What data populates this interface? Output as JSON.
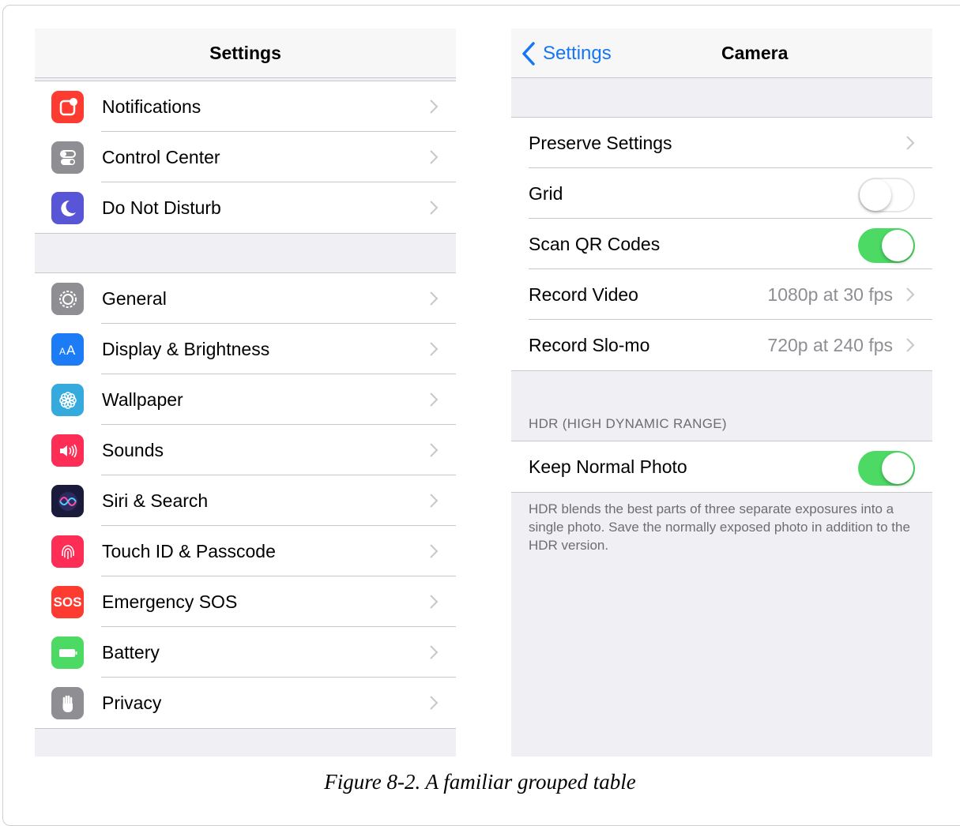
{
  "left_screen": {
    "nav_title": "Settings",
    "group1": [
      {
        "label": "Notifications",
        "icon": "notifications-icon",
        "color": "#fe3b30"
      },
      {
        "label": "Control Center",
        "icon": "control-center-icon",
        "color": "#8e8e93"
      },
      {
        "label": "Do Not Disturb",
        "icon": "moon-icon",
        "color": "#5856d6"
      }
    ],
    "group2": [
      {
        "label": "General",
        "icon": "gear-icon",
        "color": "#8e8e93"
      },
      {
        "label": "Display & Brightness",
        "icon": "text-size-icon",
        "color": "#1c7cf6"
      },
      {
        "label": "Wallpaper",
        "icon": "flower-icon",
        "color": "#35aadc"
      },
      {
        "label": "Sounds",
        "icon": "speaker-icon",
        "color": "#fe2d55"
      },
      {
        "label": "Siri & Search",
        "icon": "siri-icon",
        "color": "#1a1a3a"
      },
      {
        "label": "Touch ID & Passcode",
        "icon": "fingerprint-icon",
        "color": "#fe2d55"
      },
      {
        "label": "Emergency SOS",
        "icon": "sos-icon",
        "color": "#fe3b30",
        "glyph": "SOS"
      },
      {
        "label": "Battery",
        "icon": "battery-icon",
        "color": "#4cd964"
      },
      {
        "label": "Privacy",
        "icon": "hand-icon",
        "color": "#8e8e93"
      }
    ]
  },
  "right_screen": {
    "back_label": "Settings",
    "nav_title": "Camera",
    "rows": {
      "preserve": {
        "label": "Preserve Settings"
      },
      "grid": {
        "label": "Grid",
        "on": false
      },
      "scan_qr": {
        "label": "Scan QR Codes",
        "on": true
      },
      "record_video": {
        "label": "Record Video",
        "value": "1080p at 30 fps"
      },
      "record_slomo": {
        "label": "Record Slo-mo",
        "value": "720p at 240 fps"
      }
    },
    "hdr_header": "HDR (HIGH DYNAMIC RANGE)",
    "keep_normal": {
      "label": "Keep Normal Photo",
      "on": true
    },
    "hdr_footer": "HDR blends the best parts of three separate exposures into a single photo. Save the normally exposed photo in addition to the HDR version."
  },
  "caption": "Figure 8-2. A familiar grouped table",
  "colors": {
    "accent": "#1476f5",
    "toggle_on": "#4cd964",
    "grouped_bg": "#efeff4"
  }
}
